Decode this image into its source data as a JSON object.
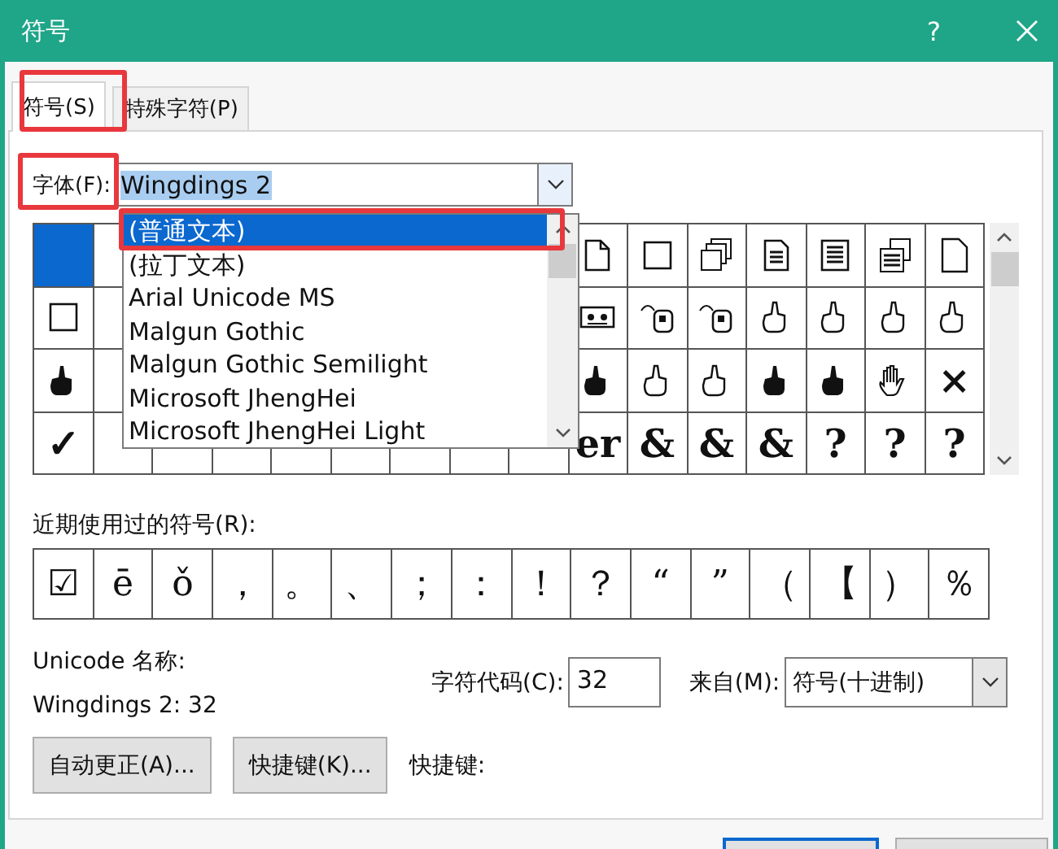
{
  "window": {
    "title": "符号",
    "help_button": "?"
  },
  "tabs": [
    {
      "label": "符号(S)",
      "selected": true
    },
    {
      "label": "特殊字符(P)",
      "selected": false
    }
  ],
  "font": {
    "label": "字体(F):",
    "value": "Wingdings 2",
    "text_selected": true
  },
  "font_dropdown": {
    "items": [
      {
        "label": "(普通文本)",
        "selected": true
      },
      {
        "label": "(拉丁文本)",
        "selected": false
      },
      {
        "label": "Arial Unicode MS",
        "selected": false
      },
      {
        "label": "Malgun Gothic",
        "selected": false
      },
      {
        "label": "Malgun Gothic Semilight",
        "selected": false
      },
      {
        "label": "Microsoft JhengHei",
        "selected": false
      },
      {
        "label": "Microsoft JhengHei Light",
        "selected": false
      }
    ]
  },
  "symbol_grid": {
    "rows": [
      {
        "cells": [
          {
            "kind": "blank",
            "selected": true
          },
          {
            "kind": "icon",
            "selected": false
          },
          {
            "kind": "icon",
            "selected": false
          },
          {
            "kind": "icon",
            "selected": false
          },
          {
            "kind": "icon",
            "selected": false
          },
          {
            "kind": "icon",
            "selected": false
          },
          {
            "kind": "icon",
            "selected": false
          },
          {
            "kind": "icon",
            "selected": false
          }
        ]
      },
      {
        "cells": [
          {
            "kind": "icon",
            "selected": false
          },
          {
            "kind": "icon",
            "selected": false
          },
          {
            "kind": "icon",
            "selected": false
          },
          {
            "kind": "icon",
            "selected": false
          },
          {
            "kind": "icon",
            "selected": false
          },
          {
            "kind": "icon",
            "selected": false
          },
          {
            "kind": "icon",
            "selected": false
          },
          {
            "kind": "icon",
            "selected": false
          }
        ]
      },
      {
        "cells": [
          {
            "kind": "icon",
            "selected": false
          },
          {
            "kind": "icon",
            "selected": false
          },
          {
            "kind": "icon",
            "selected": false
          },
          {
            "kind": "icon",
            "selected": false
          },
          {
            "kind": "icon",
            "selected": false
          },
          {
            "kind": "icon",
            "selected": false
          },
          {
            "kind": "icon",
            "selected": false
          },
          {
            "kind": "text",
            "text": "×",
            "selected": false
          }
        ]
      },
      {
        "cells": [
          {
            "kind": "text",
            "text": "✓",
            "selected": false
          },
          {
            "kind": "text",
            "text": "er",
            "selected": false
          },
          {
            "kind": "text",
            "text": "&",
            "selected": false
          },
          {
            "kind": "text",
            "text": "&",
            "selected": false
          },
          {
            "kind": "text",
            "text": "&",
            "selected": false
          },
          {
            "kind": "text",
            "text": "?",
            "selected": false
          },
          {
            "kind": "text",
            "text": "?",
            "selected": false
          },
          {
            "kind": "text",
            "text": "?",
            "selected": false
          }
        ]
      }
    ]
  },
  "recent": {
    "label": "近期使用过的符号(R):",
    "symbols": [
      "☑",
      "ē",
      "ǒ",
      "，",
      "。",
      "、",
      "；",
      "：",
      "！",
      "？",
      "“",
      "”",
      "（",
      "【",
      "）",
      "％"
    ]
  },
  "unicode_name": {
    "label": "Unicode 名称:",
    "value": "Wingdings 2: 32"
  },
  "char_code": {
    "label": "字符代码(C):",
    "value": "32"
  },
  "from": {
    "label": "来自(M):",
    "value": "符号(十进制)"
  },
  "buttons": [
    {
      "label": "自动更正(A)..."
    },
    {
      "label": "快捷键(K)..."
    }
  ],
  "shortcut_label": "快捷键:"
}
